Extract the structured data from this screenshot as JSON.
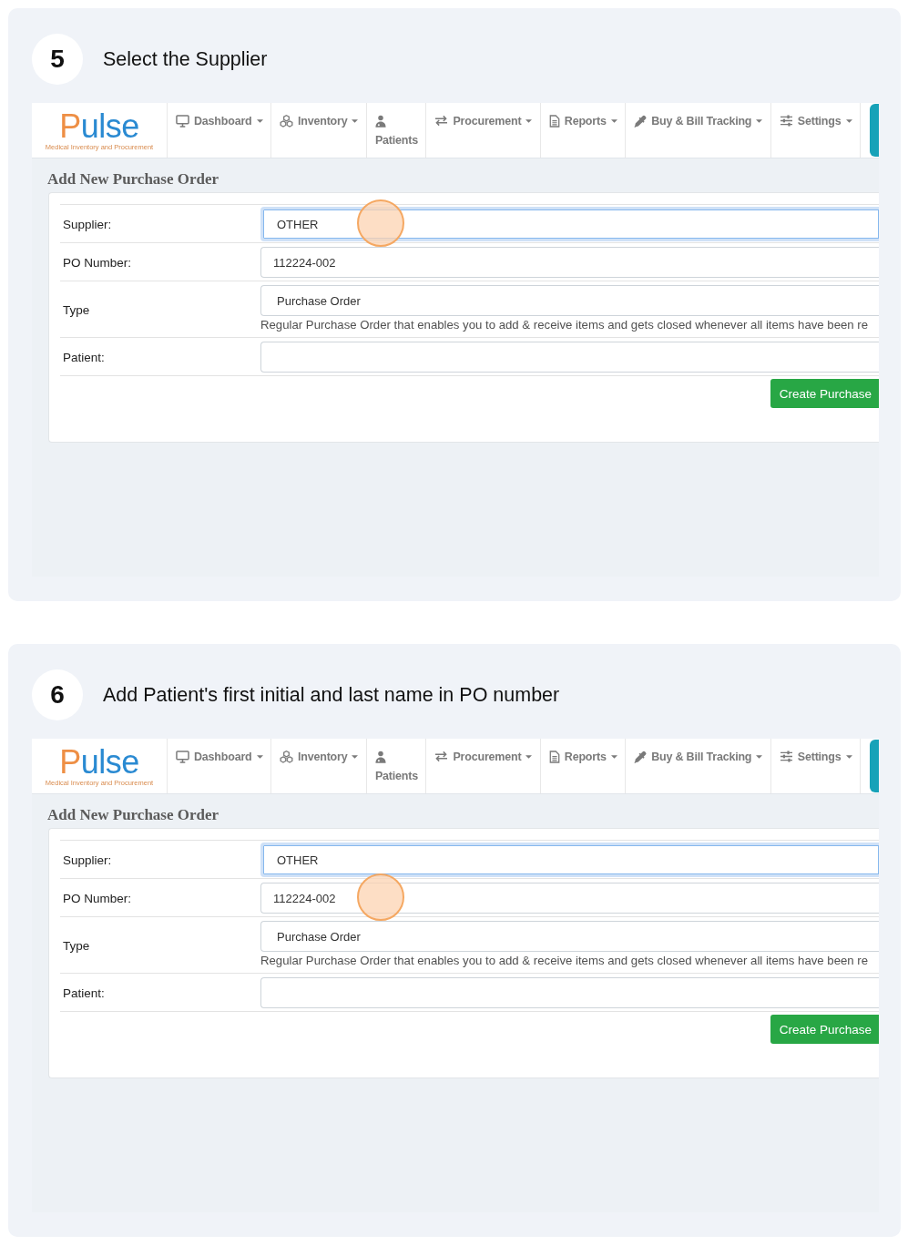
{
  "steps": [
    {
      "number": "5",
      "title": "Select the Supplier",
      "screenshot": {
        "logo": {
          "name": "Pulse",
          "tagline": "Medical Inventory and Procurement"
        },
        "nav": [
          {
            "label": "Dashboard",
            "kind": "dropdown"
          },
          {
            "label": "Inventory",
            "kind": "dropdown"
          },
          {
            "label": "Patients",
            "kind": "link"
          },
          {
            "label": "Procurement",
            "kind": "dropdown"
          },
          {
            "label": "Reports",
            "kind": "dropdown"
          },
          {
            "label": "Buy & Bill Tracking",
            "kind": "dropdown"
          },
          {
            "label": "Settings",
            "kind": "dropdown"
          }
        ],
        "page_title": "Add New Purchase Order",
        "form": {
          "rows": [
            {
              "label": "Supplier:",
              "kind": "select",
              "value": "OTHER",
              "focused": true,
              "click_marker": true
            },
            {
              "label": "PO Number:",
              "kind": "input",
              "value": "112224-002",
              "focused": false,
              "click_marker": false
            },
            {
              "label": "Type",
              "kind": "select",
              "value": "Purchase Order",
              "help": "Regular Purchase Order that enables you to add & receive items and gets closed whenever all items have been re",
              "focused": false,
              "click_marker": false
            },
            {
              "label": "Patient:",
              "kind": "input",
              "focused": false,
              "click_marker": false
            }
          ],
          "submit": "Create Purchase"
        }
      }
    },
    {
      "number": "6",
      "title": "Add Patient's first initial and last name in PO number",
      "screenshot": {
        "logo": {
          "name": "Pulse",
          "tagline": "Medical Inventory and Procurement"
        },
        "nav": [
          {
            "label": "Dashboard",
            "kind": "dropdown"
          },
          {
            "label": "Inventory",
            "kind": "dropdown"
          },
          {
            "label": "Patients",
            "kind": "link"
          },
          {
            "label": "Procurement",
            "kind": "dropdown"
          },
          {
            "label": "Reports",
            "kind": "dropdown"
          },
          {
            "label": "Buy & Bill Tracking",
            "kind": "dropdown"
          },
          {
            "label": "Settings",
            "kind": "dropdown"
          }
        ],
        "page_title": "Add New Purchase Order",
        "form": {
          "rows": [
            {
              "label": "Supplier:",
              "kind": "select",
              "value": "OTHER",
              "focused": true,
              "click_marker": false
            },
            {
              "label": "PO Number:",
              "kind": "input",
              "value": "112224-002",
              "focused": false,
              "click_marker": true
            },
            {
              "label": "Type",
              "kind": "select",
              "value": "Purchase Order",
              "help": "Regular Purchase Order that enables you to add & receive items and gets closed whenever all items have been re",
              "focused": false,
              "click_marker": false
            },
            {
              "label": "Patient:",
              "kind": "input",
              "focused": false,
              "click_marker": false
            }
          ],
          "submit": "Create Purchase"
        }
      }
    }
  ]
}
